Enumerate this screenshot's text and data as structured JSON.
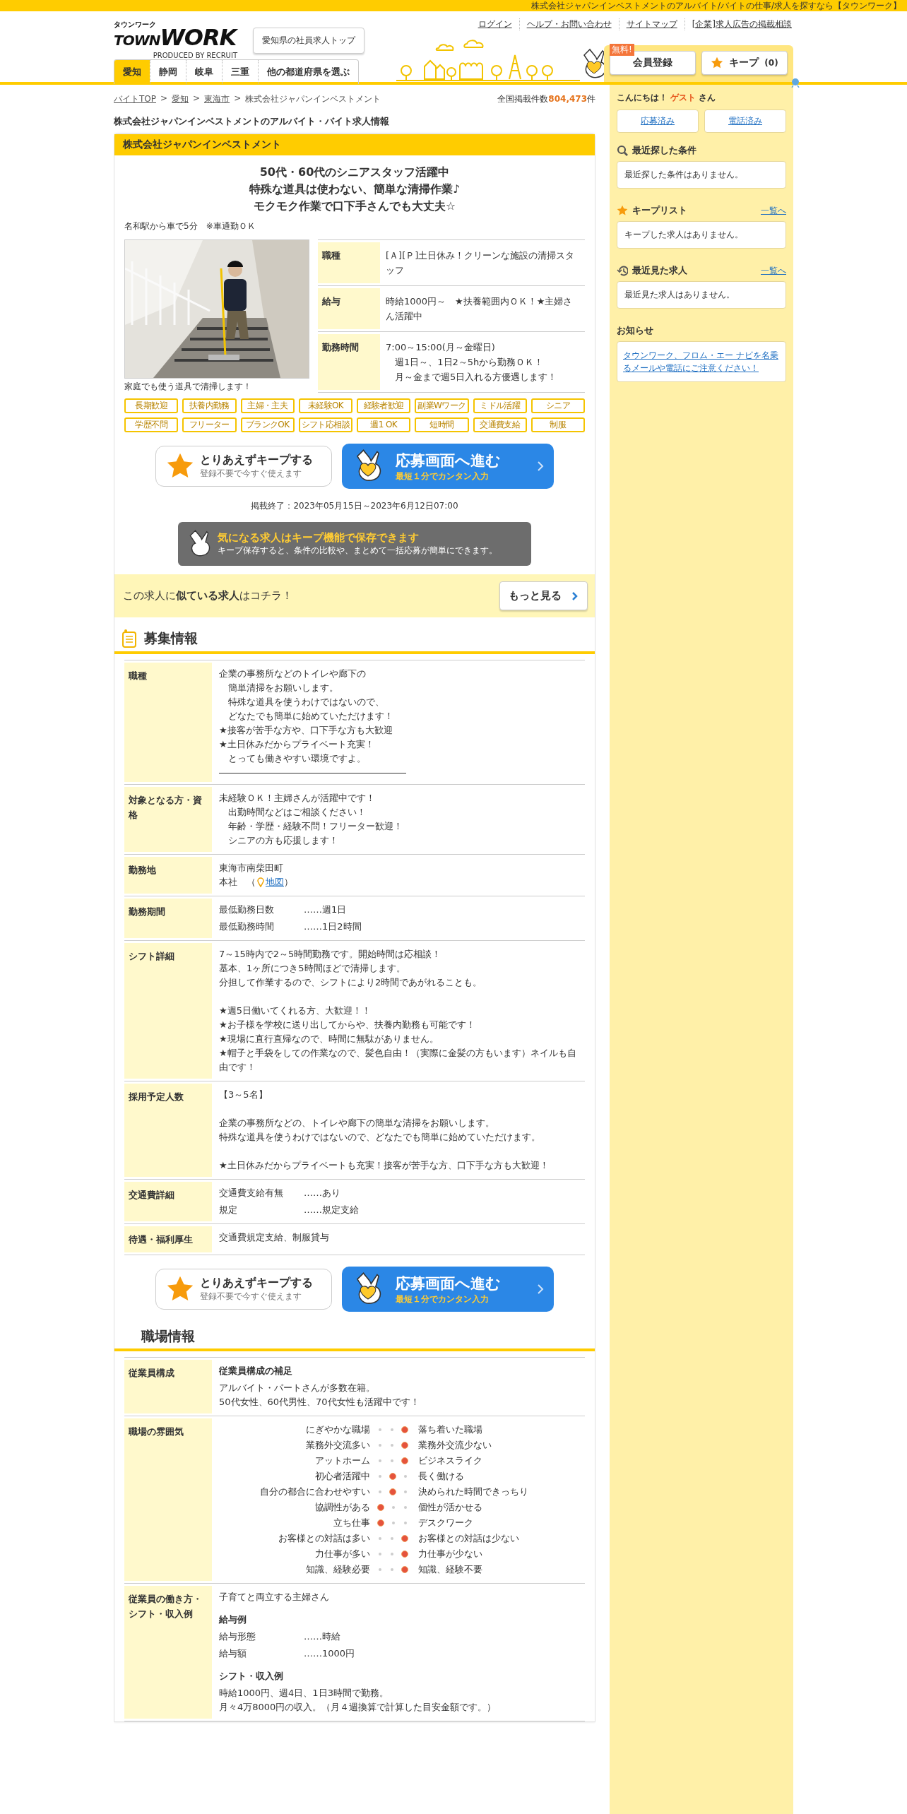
{
  "top_strip": {
    "text": "株式会社ジャパンインベストメントのアルバイト/バイトの仕事/求人を探すなら【タウンワーク】"
  },
  "header": {
    "logo": {
      "kana": "タウンワーク",
      "wordmark": [
        "TOWN",
        "WORK"
      ],
      "byline": "PRODUCED BY RECRUIT"
    },
    "top_button": "愛知県の社員求人トップ",
    "links": [
      "ログイン",
      "ヘルプ・お問い合わせ",
      "サイトマップ",
      "[企業]求人広告の掲載相談"
    ],
    "tabs": [
      {
        "label": "愛知",
        "selected": true
      },
      {
        "label": "静岡",
        "selected": false
      },
      {
        "label": "岐阜",
        "selected": false
      },
      {
        "label": "三重",
        "selected": false
      },
      {
        "label": "他の都道府県を選ぶ",
        "selected": false
      }
    ],
    "register": {
      "badge": "無料!",
      "label": "会員登録"
    },
    "keep": {
      "label": "キープ",
      "count": "(0)"
    }
  },
  "breadcrumb": {
    "separator": ">",
    "items": [
      {
        "label": "バイトTOP",
        "link": true
      },
      {
        "label": "愛知",
        "link": true
      },
      {
        "label": "東海市",
        "link": true
      },
      {
        "label": "株式会社ジャパンインベストメント",
        "link": false
      }
    ]
  },
  "total": {
    "label": "全国掲載件数",
    "count": "804,473",
    "unit": "件"
  },
  "page_title": "株式会社ジャパンインベストメントのアルバイト・バイト求人情報",
  "job": {
    "company": "株式会社ジャパンインベストメント",
    "headline": [
      "50代・60代のシニアスタッフ活躍中",
      "特殊な道具は使わない、簡単な清掃作業♪",
      "モクモク作業で口下手さんでも大丈夫☆"
    ],
    "access": "名和駅から車で5分　※車通勤ＯＫ",
    "photo_caption": "家庭でも使う道具で清掃します！",
    "summary": [
      {
        "label": "職種",
        "lines": [
          "[Ａ][Ｐ]土日休み！クリーンな施設の清掃スタッフ"
        ]
      },
      {
        "label": "給与",
        "lines": [
          "時給1000円～　★扶養範囲内ＯＫ！★主婦さん活躍中"
        ]
      },
      {
        "label": "勤務時間",
        "lines": [
          "7:00～15:00(月～金曜日)",
          "　週1日～、1日2～5hから勤務ＯＫ！",
          "　月～金まで週5日入れる方優遇します！"
        ]
      }
    ],
    "tags": [
      "長期歓迎",
      "扶養内勤務",
      "主婦・主夫",
      "未経験OK",
      "経験者歓迎",
      "副業Wワーク",
      "ミドル活躍",
      "シニア",
      "学歴不問",
      "フリーター",
      "ブランクOK",
      "シフト応相談",
      "週1 OK",
      "短時間",
      "交通費支給",
      "制服"
    ],
    "posting_period": "掲載終了：2023年05月15日～2023年6月12日07:00",
    "keep_banner": {
      "title": "気になる求人はキープ機能で保存できます",
      "text": "キープ保存すると、条件の比較や、まとめて一括応募が簡単にできます。"
    },
    "similar": {
      "text": "この求人に**似ている求人**はコチラ！",
      "button": "もっと見る"
    }
  },
  "action_rows": [
    {
      "keep": {
        "label": "とりあえずキープする",
        "sub": "登録不要で今すぐ使えます"
      },
      "apply": {
        "label": "応募画面へ進む",
        "sub": "最短１分でカンタン入力"
      }
    },
    {
      "keep": {
        "label": "とりあえずキープする",
        "sub": "登録不要で今すぐ使えます"
      },
      "apply": {
        "label": "応募画面へ進む",
        "sub": "最短１分でカンタン入力"
      }
    }
  ],
  "recruit": {
    "heading": "募集情報",
    "rows": [
      {
        "label": "職種",
        "kind": "text",
        "rule": true,
        "paragraphs": [
          [
            "企業の事務所などのトイレや廊下の",
            "　簡単清掃をお願いします。",
            "　特殊な道具を使うわけではないので、",
            "　どなたでも簡単に始めていただけます！",
            "★接客が苦手な方や、口下手な方も大歓迎",
            "★土日休みだからプライベート充実！",
            "　とっても働きやすい環境ですよ。"
          ]
        ]
      },
      {
        "label": "対象となる方・資格",
        "kind": "text",
        "paragraphs": [
          [
            "未経験ＯＫ！主婦さんが活躍中です！",
            "　出勤時間などはご相談ください！",
            "　年齢・学歴・経験不問！フリーター歓迎！",
            "　シニアの方も応援します！"
          ]
        ]
      },
      {
        "label": "勤務地",
        "kind": "location",
        "lines": [
          "東海市南柴田町"
        ],
        "prefix": "本社　（",
        "link": "地図",
        "suffix": "）"
      },
      {
        "label": "勤務期間",
        "kind": "pairs",
        "pairs": [
          {
            "key": "最低勤務日数",
            "value": "……週1日"
          },
          {
            "key": "最低勤務時間",
            "value": "……1日2時間"
          }
        ]
      },
      {
        "label": "シフト詳細",
        "kind": "text",
        "paragraphs": [
          [
            "7～15時内で2～5時間勤務です。開始時間は応相談！",
            "基本、1ヶ所につき5時間ほどで清掃します。",
            "分担して作業するので、シフトにより2時間であがれることも。"
          ],
          [
            "★週5日働いてくれる方、大歓迎！！",
            "★お子様を学校に送り出してからや、扶養内勤務も可能です！",
            "★現場に直行直帰なので、時間に無駄がありません。",
            "★帽子と手袋をしての作業なので、髪色自由！（実際に金髪の方もいます）ネイルも自由です！"
          ]
        ]
      },
      {
        "label": "採用予定人数",
        "kind": "text",
        "paragraphs": [
          [
            "【3～5名】"
          ],
          [
            "企業の事務所などの、トイレや廊下の簡単な清掃をお願いします。",
            "特殊な道具を使うわけではないので、どなたでも簡単に始めていただけます。"
          ],
          [
            "★土日休みだからプライベートも充実！接客が苦手な方、口下手な方も大歓迎！"
          ]
        ]
      },
      {
        "label": "交通費詳細",
        "kind": "pairs",
        "pairs": [
          {
            "key": "交通費支給有無",
            "value": "……あり"
          },
          {
            "key": "規定",
            "value": "……規定支給"
          }
        ]
      },
      {
        "label": "待遇・福利厚生",
        "kind": "text",
        "paragraphs": [
          [
            "交通費規定支給、制服貸与"
          ]
        ]
      }
    ]
  },
  "workplace": {
    "heading": "職場情報",
    "rows": [
      {
        "label": "従業員構成",
        "kind": "sections",
        "sections": [
          {
            "heading": "従業員構成の補足",
            "lines": [
              "アルバイト・パートさんが多数在籍。",
              "50代女性、60代男性、70代女性も活躍中です！"
            ]
          }
        ]
      },
      {
        "label": "職場の雰囲気",
        "kind": "atmosphere",
        "items": [
          {
            "left": "にぎやかな職場",
            "right": "落ち着いた職場",
            "dots": [
              {
                "selected": false
              },
              {
                "selected": false
              },
              {
                "selected": true
              }
            ]
          },
          {
            "left": "業務外交流多い",
            "right": "業務外交流少ない",
            "dots": [
              {
                "selected": false
              },
              {
                "selected": false
              },
              {
                "selected": true
              }
            ]
          },
          {
            "left": "アットホーム",
            "right": "ビジネスライク",
            "dots": [
              {
                "selected": false
              },
              {
                "selected": false
              },
              {
                "selected": true
              }
            ]
          },
          {
            "left": "初心者活躍中",
            "right": "長く働ける",
            "dots": [
              {
                "selected": false
              },
              {
                "selected": true
              },
              {
                "selected": false
              }
            ]
          },
          {
            "left": "自分の都合に合わせやすい",
            "right": "決められた時間できっちり",
            "dots": [
              {
                "selected": false
              },
              {
                "selected": true
              },
              {
                "selected": false
              }
            ]
          },
          {
            "left": "協調性がある",
            "right": "個性が活かせる",
            "dots": [
              {
                "selected": true
              },
              {
                "selected": false
              },
              {
                "selected": false
              }
            ]
          },
          {
            "left": "立ち仕事",
            "right": "デスクワーク",
            "dots": [
              {
                "selected": true
              },
              {
                "selected": false
              },
              {
                "selected": false
              }
            ]
          },
          {
            "left": "お客様との対話は多い",
            "right": "お客様との対話は少ない",
            "dots": [
              {
                "selected": false
              },
              {
                "selected": false
              },
              {
                "selected": true
              }
            ]
          },
          {
            "left": "力仕事が多い",
            "right": "力仕事が少ない",
            "dots": [
              {
                "selected": false
              },
              {
                "selected": false
              },
              {
                "selected": true
              }
            ]
          },
          {
            "left": "知識、経験必要",
            "right": "知識、経験不要",
            "dots": [
              {
                "selected": false
              },
              {
                "selected": false
              },
              {
                "selected": true
              }
            ]
          }
        ]
      },
      {
        "label": "従業員の働き方・シフト・収入例",
        "kind": "sections",
        "sections": [
          {
            "lines": [
              "子育てと両立する主婦さん"
            ]
          },
          {
            "heading": "給与例",
            "pairs": [
              {
                "key": "給与形態",
                "value": "……時給"
              },
              {
                "key": "給与額",
                "value": "……1000円"
              }
            ]
          },
          {
            "heading": "シフト・収入例",
            "lines": [
              "時給1000円、週4日、1日3時間で勤務。",
              "月々4万8000円の収入。（月４週換算で計算した目安金額です。）"
            ]
          }
        ]
      }
    ]
  },
  "sidebar": {
    "greeting": {
      "hello": "こんにちは！",
      "name": "ゲスト",
      "suffix": "さん"
    },
    "history_buttons": [
      "応募済み",
      "電話済み"
    ],
    "panels": [
      {
        "kind": "search",
        "title": "最近探した条件",
        "message": "最近探した条件はありません。"
      },
      {
        "kind": "star",
        "title": "キープリスト",
        "link": "一覧へ",
        "message": "キープした求人はありません。"
      },
      {
        "kind": "history",
        "title": "最近見た求人",
        "link": "一覧へ",
        "message": "最近見た求人はありません。"
      }
    ],
    "notice": {
      "title": "お知らせ",
      "link": "タウンワーク、フロム・エー ナビを名乗るメールや電話にご注意ください！"
    }
  }
}
